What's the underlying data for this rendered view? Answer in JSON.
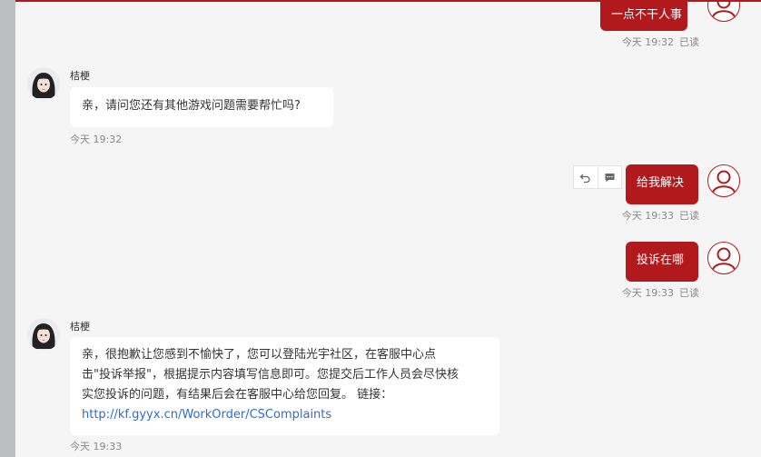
{
  "colors": {
    "accent": "#b1191c",
    "page_bg": "#f5f5f5",
    "link": "#2f6bd8"
  },
  "messages": [
    {
      "side": "out",
      "text": "一点不干人事",
      "time": "今天 19:32",
      "status": "已读"
    },
    {
      "side": "in",
      "sender": "桔梗",
      "text": "亲，请问您还有其他游戏问题需要帮忙吗?",
      "time": "今天 19:32"
    },
    {
      "side": "out",
      "text": "给我解决",
      "time": "今天 19:33",
      "status": "已读",
      "actions": [
        "undo-icon",
        "comment-icon"
      ]
    },
    {
      "side": "out",
      "text": "投诉在哪",
      "time": "今天 19:33",
      "status": "已读"
    },
    {
      "side": "in",
      "sender": "桔梗",
      "lines": [
        "亲，很抱歉让您感到不愉快了，您可以登陆光宇社区，在客服中心点",
        "击\"投诉举报\"，根据提示内容填写信息即可。您提交后工作人员会尽快核",
        "实您投诉的问题，有结果后会在客服中心给您回复。 链接："
      ],
      "link": "http://kf.gyyx.cn/WorkOrder/CSComplaints",
      "time": "今天 19:33"
    }
  ]
}
